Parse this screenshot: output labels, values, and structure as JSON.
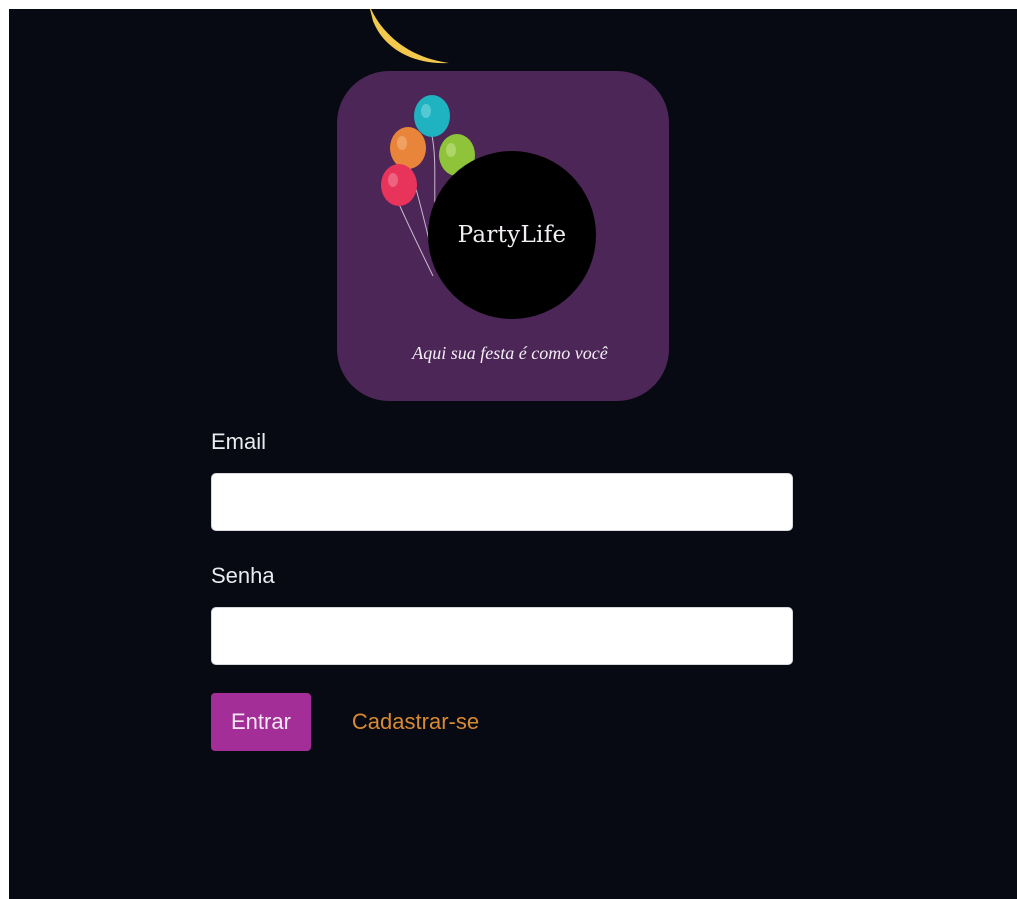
{
  "logo": {
    "brand_name": "PartyLife",
    "tagline": "Aqui sua festa é como você",
    "card_color": "#4b2656",
    "balloon_colors": [
      "#1fb3c2",
      "#e9853a",
      "#8fc43a",
      "#e8345a"
    ],
    "moon_color": "#f2c94c"
  },
  "form": {
    "email_label": "Email",
    "email_value": "",
    "email_placeholder": "",
    "password_label": "Senha",
    "password_value": "",
    "password_placeholder": "",
    "submit_label": "Entrar",
    "signup_label": "Cadastrar-se"
  },
  "colors": {
    "background": "#070a12",
    "button": "#a42e97",
    "link": "#d88a33"
  }
}
